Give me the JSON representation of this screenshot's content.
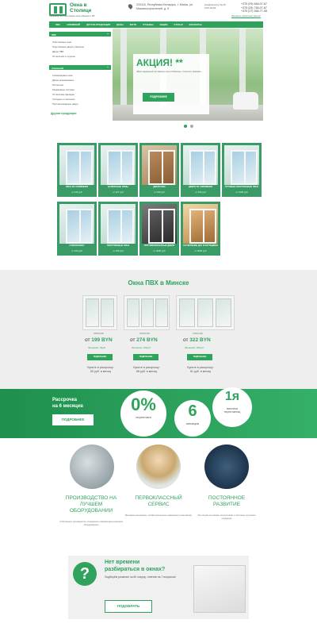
{
  "header": {
    "logo_name": "Окна в Столице",
    "logo_tagline": "Производство пластиковых окон в Минске и РБ",
    "address": "220116, Республика Беларусь, г. Минск, ул. Машиностроителей, д. 5",
    "email": "info@okna.by Пн-Пт 9:00-18:00",
    "phones": [
      "+375 (29) 648-07-67",
      "+375 (29) 736-07-67",
      "+375 (17) 268-77-08"
    ],
    "callback_label": "Заказать обратный звонок"
  },
  "nav": {
    "items": [
      "ПВХ",
      "АЛЮМИНИЙ",
      "ДРУГАЯ ПРОДУКЦИЯ",
      "ЦЕНЫ",
      "ФОТО",
      "ОТЗЫВЫ",
      "АКЦИИ",
      "СТАТЬИ",
      "КОНТАКТЫ"
    ]
  },
  "sidebar": {
    "pvc_head": "ПВХ",
    "pvc_items": [
      "Пластиковые окна",
      "Пластиковые двери и балконы",
      "Двери ПВХ",
      "Остекление и отделка"
    ],
    "alu_head": "Алюминий",
    "alu_items": [
      "Алюминиевые окна",
      "Двери алюминиевые",
      "Роллетные",
      "Раздвижные системы",
      "Остекление фасадов",
      "Холодное остекление",
      "Противопожарные двери"
    ],
    "other": "Другая продукция"
  },
  "hero": {
    "title": "АКЦИЯ! **",
    "text": "«Ваш надёжный поставщик окон в Минске». Спешите заказать.",
    "button": "ПОДРОБНЕЕ"
  },
  "products": [
    {
      "title": "ОКНА ИЗ АЛЮМИНИЯ",
      "price": "от 115 руб"
    },
    {
      "title": "БАЛКОННЫЕ РАМЫ",
      "price": "от 227 руб"
    },
    {
      "title": "ДВЕРИ ПВХ",
      "price": "от 330 руб"
    },
    {
      "title": "ДВЕРИ ИЗ АЛЮМИНИЯ",
      "price": "от 460 руб"
    },
    {
      "title": "ГОТОВЫЕ ПЛАСТИКОВЫЕ ОКНА",
      "price": "от 2100 руб"
    },
    {
      "title": "СТЕКЛОПАКЕТ",
      "price": "от 150 руб"
    },
    {
      "title": "ПЛАСТИКОВЫЕ ОКНА",
      "price": "от 180 руб"
    },
    {
      "title": "ПРОТИВОПОЖАРНЫЕ ДВЕРИ",
      "price": "от 3000 руб"
    },
    {
      "title": "ОСТЕКЛЕНИЕ ДАЧ И КОТТЕДЖЕЙ",
      "price": "от 5000 руб"
    }
  ],
  "windows_section": {
    "title": "Окна ПВХ в Минске",
    "items": [
      {
        "size": "1800х1400",
        "price": "199",
        "currency": "BYN",
        "save": "Экономия: 70руб.",
        "button": "ПОДРОБНЕЕ",
        "installment": [
          "Купите в рассрочку:",
          "50 руб. в месяц"
        ]
      },
      {
        "size": "2000х1400",
        "price": "274",
        "currency": "BYN",
        "save": "Экономия: 120руб.",
        "button": "ПОДРОБНЕЕ",
        "installment": [
          "Купите в рассрочку:",
          "68 руб. в месяц"
        ]
      },
      {
        "size": "2100х1400",
        "price": "322",
        "currency": "BYN",
        "save": "Экономия: 160руб.",
        "button": "ПОДРОБНЕЕ",
        "installment": [
          "Купите в рассрочку:",
          "81 руб. в месяц"
        ]
      }
    ]
  },
  "installment": {
    "title_line1": "Рассрочка",
    "title_line2": "на 6 месяцев",
    "button": "ПОДРОБНЕЕ",
    "circle1": {
      "big": "0%",
      "small": "переплата"
    },
    "circle2": {
      "big": "6",
      "small": "месяцев"
    },
    "circle3": {
      "big": "1я",
      "small1": "выплата",
      "small2": "через месяц"
    }
  },
  "features": [
    {
      "title": [
        "ПРОИЗВОДСТВО НА",
        "ЛУЧШЕМ",
        "ОБОРУДОВАНИИ"
      ],
      "text": "Собственное производство, оснащённое современным немецким оборудованием"
    },
    {
      "title": [
        "ПЕРВОКЛАССНЫЙ",
        "СЕРВИС"
      ],
      "text": "Вежливые менеджеры, профессиональные замерщики и монтажники"
    },
    {
      "title": [
        "ПОСТОЯННОЕ",
        "РАЗВИТИЕ"
      ],
      "text": "Мы следим за новыми технологиями и постоянно улучшаем продукцию"
    }
  ],
  "quiz": {
    "mark": "?",
    "title_line1": "Нет времени",
    "title_line2": "разбираться в окнах?",
    "text": "Подберём решение за 60 секунд, ответив на 7 вопросов!",
    "button": "ПОДОБРАТЬ"
  },
  "colors": {
    "accent": "#2fa35c",
    "band": "#28a05c",
    "section_bg": "#eeeeee"
  }
}
